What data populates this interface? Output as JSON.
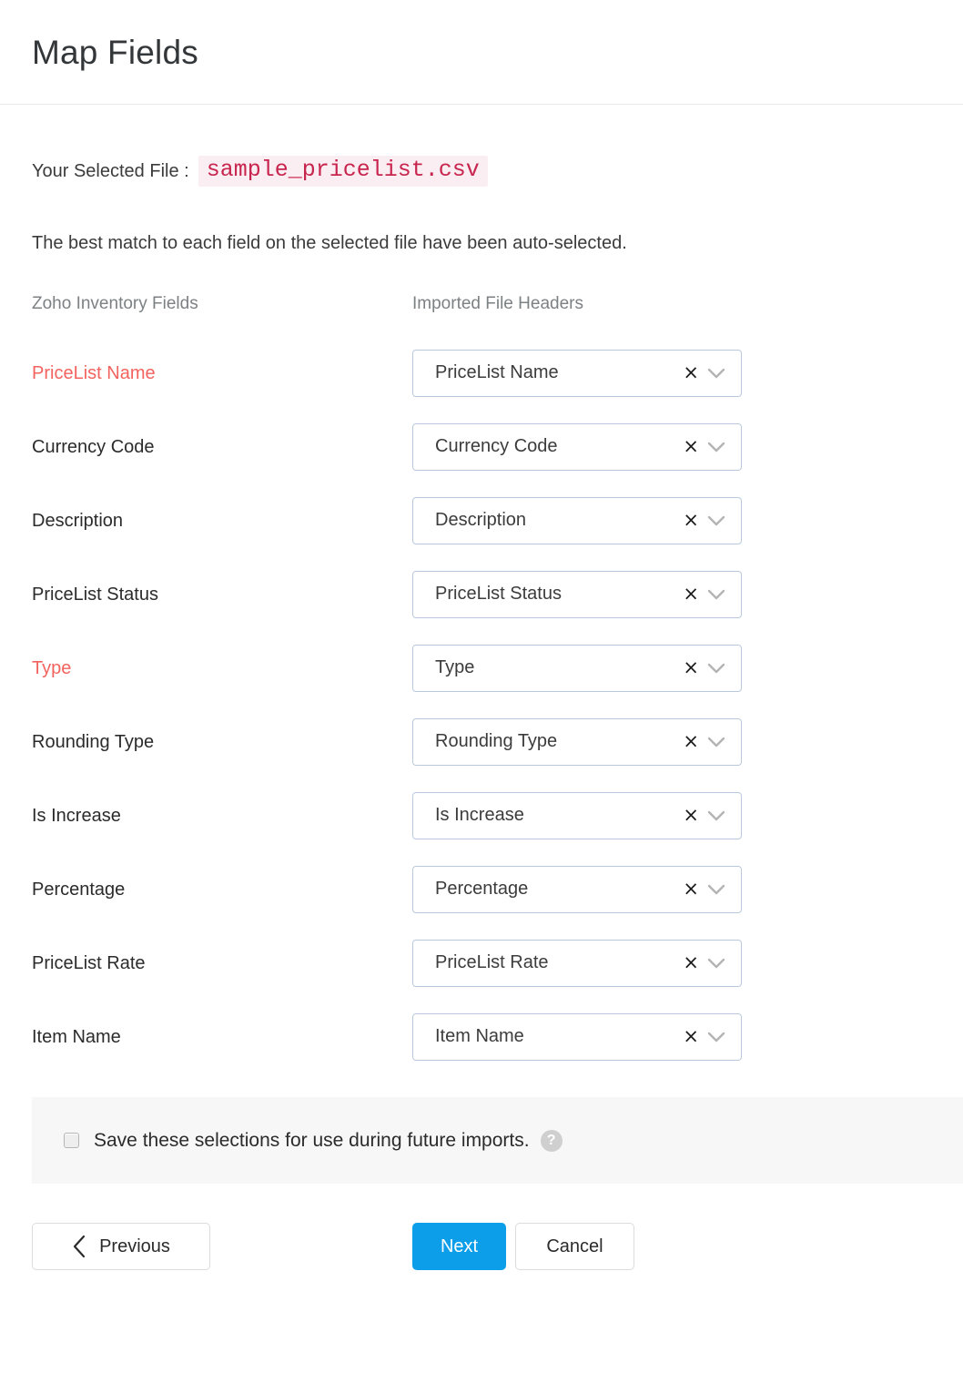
{
  "header": {
    "title": "Map Fields"
  },
  "file_info": {
    "label": "Your Selected File :",
    "file_name": "sample_pricelist.csv",
    "subtitle": "The best match to each field on the selected file have been auto-selected."
  },
  "columns": {
    "left_header": "Zoho Inventory Fields",
    "right_header": "Imported File Headers"
  },
  "rows": [
    {
      "field": "PriceList Name",
      "required": true,
      "mapped": "PriceList Name"
    },
    {
      "field": "Currency Code",
      "required": false,
      "mapped": "Currency Code"
    },
    {
      "field": "Description",
      "required": false,
      "mapped": "Description"
    },
    {
      "field": "PriceList Status",
      "required": false,
      "mapped": "PriceList Status"
    },
    {
      "field": "Type",
      "required": true,
      "mapped": "Type"
    },
    {
      "field": "Rounding Type",
      "required": false,
      "mapped": "Rounding Type"
    },
    {
      "field": "Is Increase",
      "required": false,
      "mapped": "Is Increase"
    },
    {
      "field": "Percentage",
      "required": false,
      "mapped": "Percentage"
    },
    {
      "field": "PriceList Rate",
      "required": false,
      "mapped": "PriceList Rate"
    },
    {
      "field": "Item Name",
      "required": false,
      "mapped": "Item Name"
    }
  ],
  "select_icons": {
    "clear": "×",
    "caret": "chevron-down-icon"
  },
  "save_panel": {
    "checked": false,
    "label": "Save these selections for use during future imports.",
    "help_glyph": "?"
  },
  "footer": {
    "previous_label": "Previous",
    "next_label": "Next",
    "cancel_label": "Cancel"
  },
  "colors": {
    "required_red": "#f2635f",
    "file_name_text": "#c7254e",
    "file_name_bg": "#fbeef2",
    "primary_blue": "#0c9ee8",
    "select_border": "#b9c9dd",
    "muted_header": "#7c8184",
    "panel_bg": "#f7f7f7"
  }
}
